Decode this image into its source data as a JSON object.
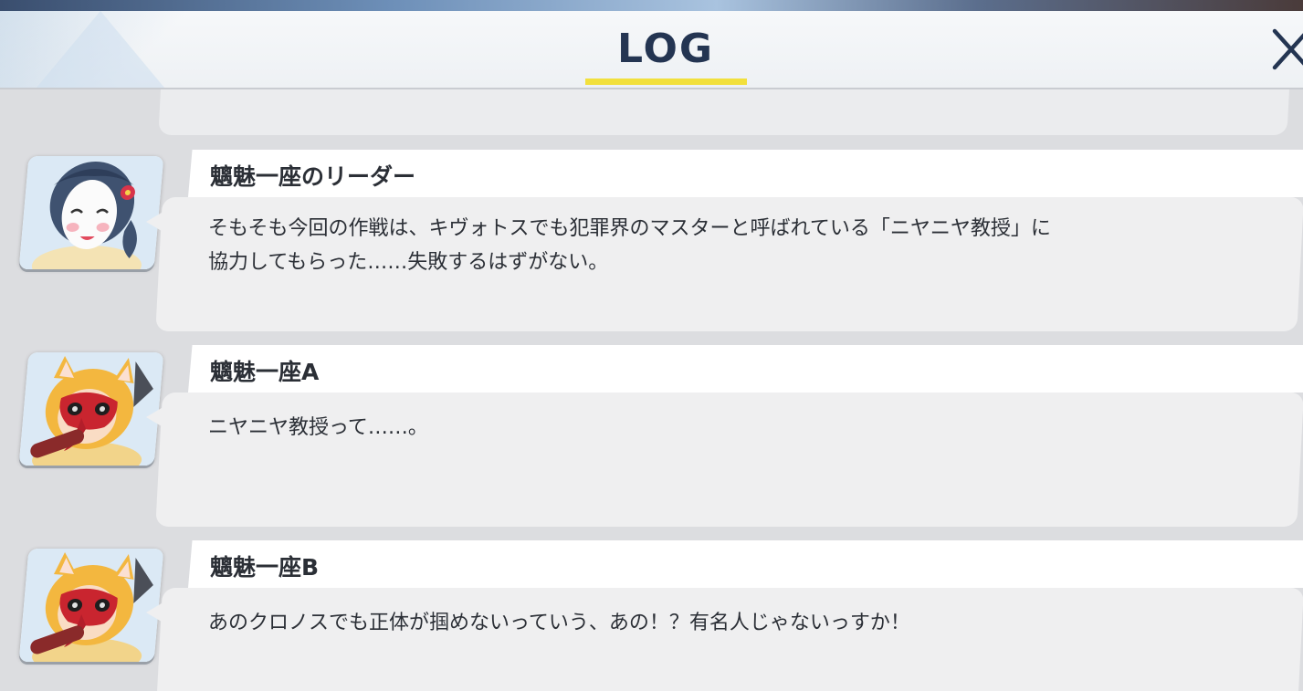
{
  "header": {
    "title": "LOG",
    "close_icon": "close-icon",
    "accent_color": "#f2e03c",
    "title_color": "#243552"
  },
  "log": {
    "entries": [
      {
        "speaker": "魑魅一座のリーダー",
        "avatar_icon": "masked-girl-white-mask-avatar",
        "text": "そもそも今回の作戦は、キヴォトスでも犯罪界のマスターと呼ばれている「ニヤニヤ教授」に\n協力してもらった……失敗するはずがない。"
      },
      {
        "speaker": "魑魅一座A",
        "avatar_icon": "fox-girl-red-mask-avatar",
        "text": "ニヤニヤ教授って……。"
      },
      {
        "speaker": "魑魅一座B",
        "avatar_icon": "fox-girl-red-mask-avatar",
        "text": "あのクロノスでも正体が掴めないっていう、あの！？有名人じゃないっすか！"
      }
    ]
  }
}
